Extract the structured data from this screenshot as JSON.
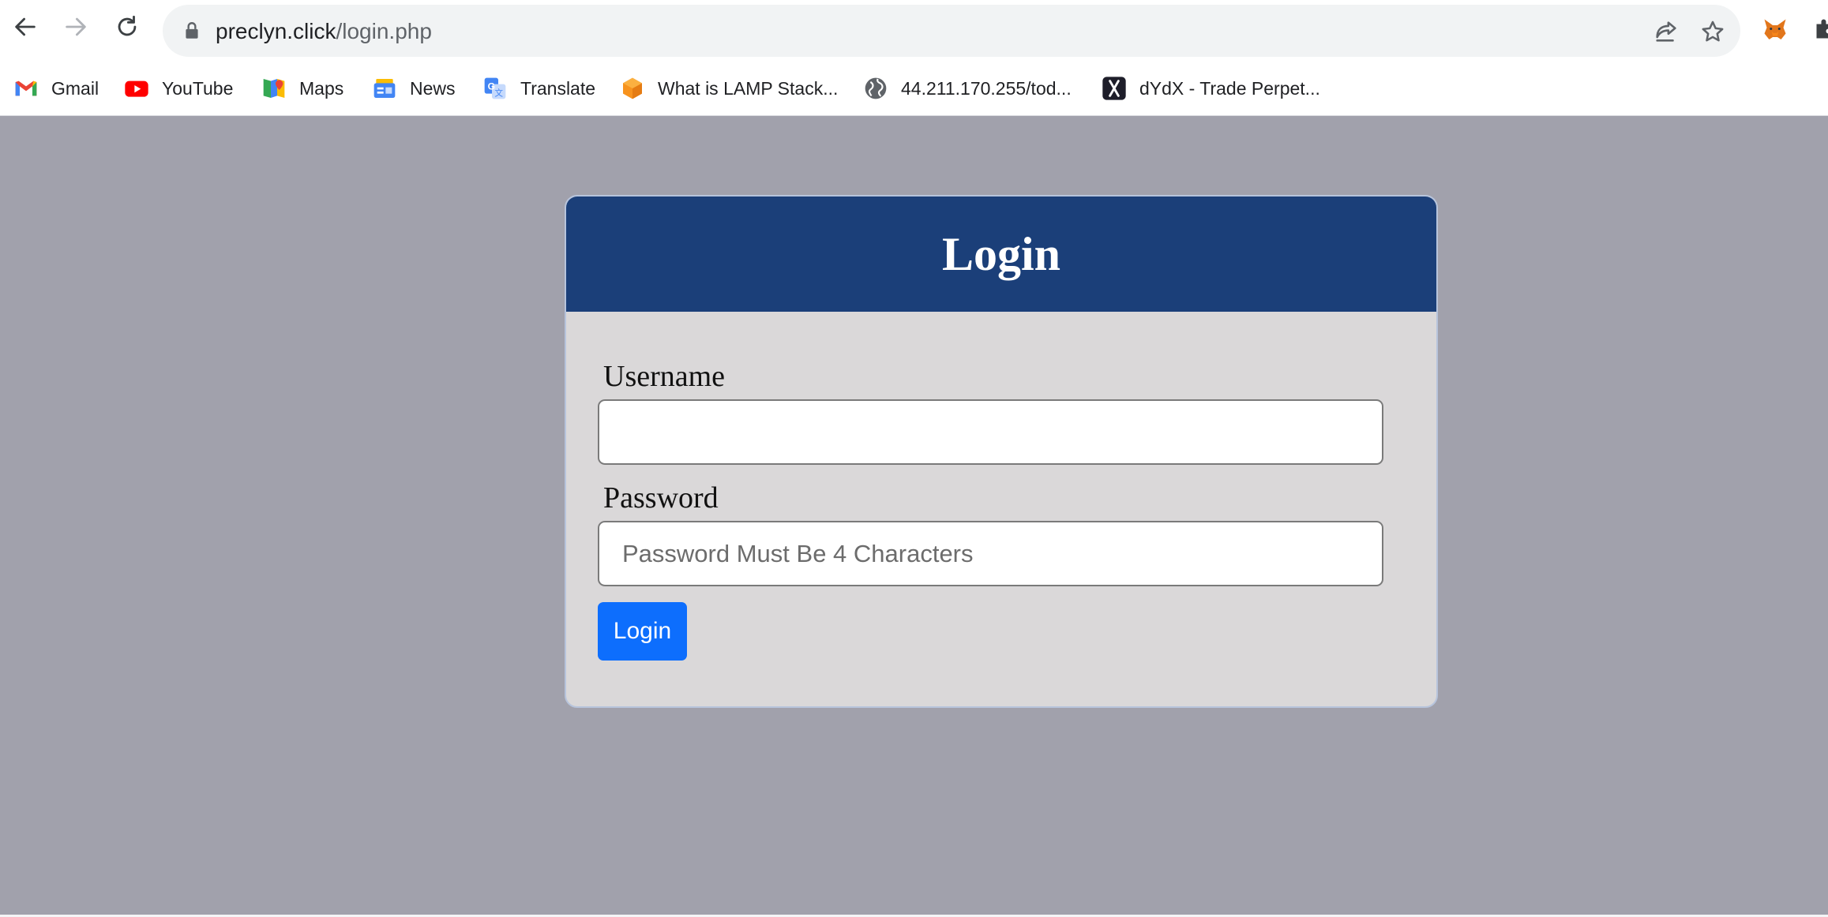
{
  "browser": {
    "url_host": "preclyn.click",
    "url_path": "/login.php",
    "bookmarks": [
      {
        "label": "Gmail",
        "icon": "gmail-icon"
      },
      {
        "label": "YouTube",
        "icon": "youtube-icon"
      },
      {
        "label": "Maps",
        "icon": "maps-icon"
      },
      {
        "label": "News",
        "icon": "news-icon"
      },
      {
        "label": "Translate",
        "icon": "translate-icon"
      },
      {
        "label": "What is LAMP Stack...",
        "icon": "lamp-cube-icon"
      },
      {
        "label": "44.211.170.255/tod...",
        "icon": "globe-icon"
      },
      {
        "label": "dYdX - Trade Perpet...",
        "icon": "dydx-icon"
      }
    ]
  },
  "login": {
    "title": "Login",
    "username_label": "Username",
    "username_value": "",
    "password_label": "Password",
    "password_placeholder": "Password Must Be 4 Characters",
    "submit_label": "Login"
  },
  "colors": {
    "page_background": "#a1a1ac",
    "card_header": "#1b3f79",
    "card_body": "#dad8d9",
    "button": "#0d6efd"
  }
}
